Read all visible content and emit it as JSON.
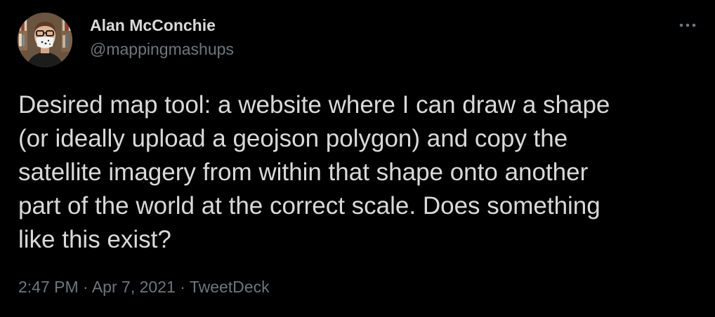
{
  "author": {
    "display_name": "Alan McConchie",
    "handle": "@mappingmashups",
    "avatar_icon": "user-avatar"
  },
  "more_icon": "more-horizontal-icon",
  "tweet": {
    "text": "Desired map tool: a website where I can draw a shape\n(or ideally upload a geojson polygon) and copy the\nsatellite imagery from within that shape onto another\npart of the world at the correct scale. Does something\nlike this exist?"
  },
  "meta": {
    "time": "2:47 PM",
    "separator": "·",
    "date": "Apr 7, 2021",
    "source": "TweetDeck"
  },
  "colors": {
    "background": "#000000",
    "text": "#d9d9d9",
    "secondary": "#6e767d"
  }
}
